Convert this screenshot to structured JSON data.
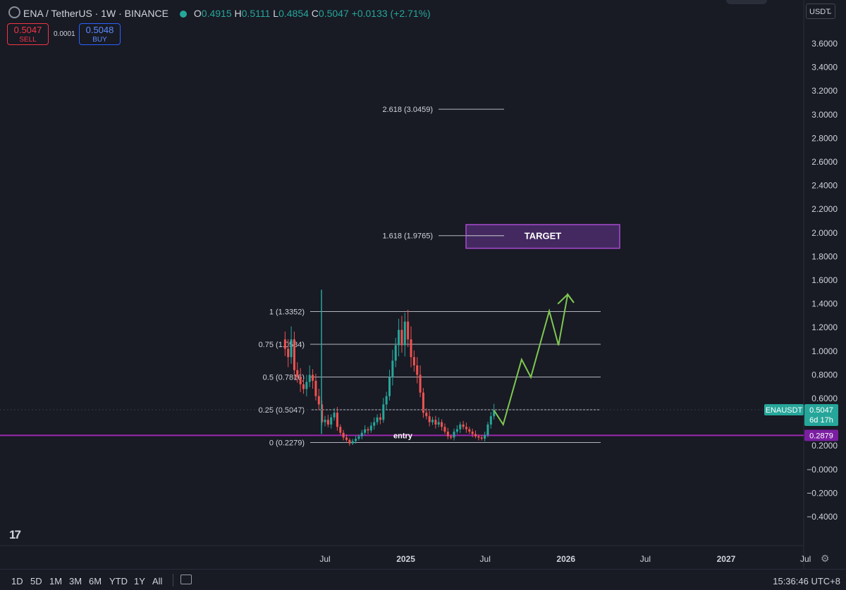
{
  "header": {
    "symbol": "ENA / TetherUS · 1W · BINANCE",
    "o_label": "O",
    "o_value": "0.4915",
    "h_label": "H",
    "h_value": "0.5111",
    "l_label": "L",
    "l_value": "0.4854",
    "c_label": "C",
    "c_value": "0.5047",
    "change": "+0.0133 (+2.71%)"
  },
  "trade": {
    "sell_price": "0.5047",
    "sell_label": "SELL",
    "spread": "0.0001",
    "buy_price": "0.5048",
    "buy_label": "BUY"
  },
  "currency": "USDT",
  "colors": {
    "up": "#26a69a",
    "down": "#ef5350",
    "projection": "#7ec850",
    "entry_line": "#9c27b0",
    "target_box": "#a84bd0",
    "background": "#181a24"
  },
  "chart_data": {
    "type": "candlestick",
    "symbol": "ENAUSDT",
    "timeframe": "1W",
    "price_axis": {
      "ticks": [
        "3.6000",
        "3.4000",
        "3.2000",
        "3.0000",
        "2.8000",
        "2.6000",
        "2.4000",
        "2.2000",
        "2.0000",
        "1.8000",
        "1.6000",
        "1.4000",
        "1.2000",
        "1.0000",
        "0.8000",
        "0.6000",
        "0.4000",
        "0.2000",
        "−0.0000",
        "−0.2000",
        "−0.4000"
      ],
      "tick_values": [
        3.6,
        3.4,
        3.2,
        3.0,
        2.8,
        2.6,
        2.4,
        2.2,
        2.0,
        1.8,
        1.6,
        1.4,
        1.2,
        1.0,
        0.8,
        0.6,
        0.4,
        0.2,
        0,
        -0.2,
        -0.4
      ],
      "range": [
        -0.5,
        3.75
      ]
    },
    "time_axis": {
      "labels": [
        "Jul",
        "2025",
        "Jul",
        "2026",
        "Jul",
        "2027",
        "Jul"
      ],
      "label_dates": [
        "2024-07",
        "2025-01",
        "2025-07",
        "2026-01",
        "2026-07",
        "2027-01",
        "2027-07"
      ],
      "range": [
        "2024-03-25",
        "2027-08-30"
      ]
    },
    "weekly_close_approx": [
      [
        "2024-04-01",
        1.02
      ],
      [
        "2024-04-08",
        0.95
      ],
      [
        "2024-04-15",
        1.1
      ],
      [
        "2024-04-22",
        0.84
      ],
      [
        "2024-04-29",
        0.78
      ],
      [
        "2024-05-06",
        0.72
      ],
      [
        "2024-05-13",
        0.68
      ],
      [
        "2024-05-20",
        0.74
      ],
      [
        "2024-05-27",
        0.8
      ],
      [
        "2024-06-03",
        0.75
      ],
      [
        "2024-06-10",
        0.62
      ],
      [
        "2024-06-17",
        0.55
      ],
      [
        "2024-06-24",
        0.4
      ],
      [
        "2024-07-01",
        0.42
      ],
      [
        "2024-07-08",
        0.38
      ],
      [
        "2024-07-15",
        0.44
      ],
      [
        "2024-07-22",
        0.48
      ],
      [
        "2024-07-29",
        0.36
      ],
      [
        "2024-08-05",
        0.31
      ],
      [
        "2024-08-12",
        0.27
      ],
      [
        "2024-08-19",
        0.25
      ],
      [
        "2024-08-26",
        0.22
      ],
      [
        "2024-09-02",
        0.24
      ],
      [
        "2024-09-09",
        0.26
      ],
      [
        "2024-09-16",
        0.28
      ],
      [
        "2024-09-23",
        0.31
      ],
      [
        "2024-09-30",
        0.34
      ],
      [
        "2024-10-07",
        0.33
      ],
      [
        "2024-10-14",
        0.37
      ],
      [
        "2024-10-21",
        0.4
      ],
      [
        "2024-10-28",
        0.44
      ],
      [
        "2024-11-04",
        0.42
      ],
      [
        "2024-11-11",
        0.55
      ],
      [
        "2024-11-18",
        0.62
      ],
      [
        "2024-11-25",
        0.78
      ],
      [
        "2024-12-02",
        0.92
      ],
      [
        "2024-12-09",
        1.05
      ],
      [
        "2024-12-16",
        1.18
      ],
      [
        "2024-12-23",
        1.05
      ],
      [
        "2024-12-30",
        1.25
      ],
      [
        "2025-01-06",
        1.1
      ],
      [
        "2025-01-13",
        0.95
      ],
      [
        "2025-01-20",
        0.88
      ],
      [
        "2025-01-27",
        0.8
      ],
      [
        "2025-02-03",
        0.65
      ],
      [
        "2025-02-10",
        0.48
      ],
      [
        "2025-02-17",
        0.45
      ],
      [
        "2025-02-24",
        0.4
      ],
      [
        "2025-03-03",
        0.42
      ],
      [
        "2025-03-10",
        0.38
      ],
      [
        "2025-03-17",
        0.4
      ],
      [
        "2025-03-24",
        0.36
      ],
      [
        "2025-03-31",
        0.32
      ],
      [
        "2025-04-07",
        0.28
      ],
      [
        "2025-04-14",
        0.27
      ],
      [
        "2025-04-21",
        0.32
      ],
      [
        "2025-04-28",
        0.34
      ],
      [
        "2025-05-05",
        0.38
      ],
      [
        "2025-05-12",
        0.36
      ],
      [
        "2025-05-19",
        0.34
      ],
      [
        "2025-05-26",
        0.32
      ],
      [
        "2025-06-02",
        0.3
      ],
      [
        "2025-06-09",
        0.28
      ],
      [
        "2025-06-16",
        0.27
      ],
      [
        "2025-06-23",
        0.26
      ],
      [
        "2025-06-30",
        0.29
      ],
      [
        "2025-07-07",
        0.38
      ],
      [
        "2025-07-14",
        0.45
      ],
      [
        "2025-07-21",
        0.5047
      ]
    ],
    "fib_levels": [
      {
        "ratio": "0",
        "value": 0.2279,
        "label": "0 (0.2279)"
      },
      {
        "ratio": "0.25",
        "value": 0.5047,
        "label": "0.25 (0.5047)"
      },
      {
        "ratio": "0.5",
        "value": 0.7816,
        "label": "0.5 (0.7816)"
      },
      {
        "ratio": "0.75",
        "value": 1.0584,
        "label": "0.75 (1.0584)"
      },
      {
        "ratio": "1",
        "value": 1.3352,
        "label": "1 (1.3352)"
      },
      {
        "ratio": "1.618",
        "value": 1.9765,
        "label": "1.618 (1.9765)"
      },
      {
        "ratio": "2.618",
        "value": 3.0459,
        "label": "2.618 (3.0459)"
      }
    ],
    "entry_line": {
      "value": 0.2879,
      "label": "entry",
      "tag": "0.2879"
    },
    "target_box": {
      "label": "TARGET",
      "top": 2.07,
      "bottom": 1.87,
      "from": "2025-05-05",
      "to": "2026-02-02"
    },
    "projection_path": [
      [
        "2025-07-21",
        0.5
      ],
      [
        "2025-08-11",
        0.38
      ],
      [
        "2025-09-22",
        0.93
      ],
      [
        "2025-10-13",
        0.78
      ],
      [
        "2025-11-24",
        1.34
      ],
      [
        "2025-12-15",
        1.05
      ],
      [
        "2026-01-05",
        1.48
      ],
      [
        "2026-01-19",
        1.41
      ]
    ],
    "last_price": {
      "label": "ENAUSDT",
      "value": "0.5047",
      "countdown": "6d 17h"
    }
  },
  "bottom_bar": {
    "ranges": [
      "1D",
      "5D",
      "1M",
      "3M",
      "6M",
      "YTD",
      "1Y",
      "All"
    ],
    "time": "15:36:46 UTC+8"
  }
}
